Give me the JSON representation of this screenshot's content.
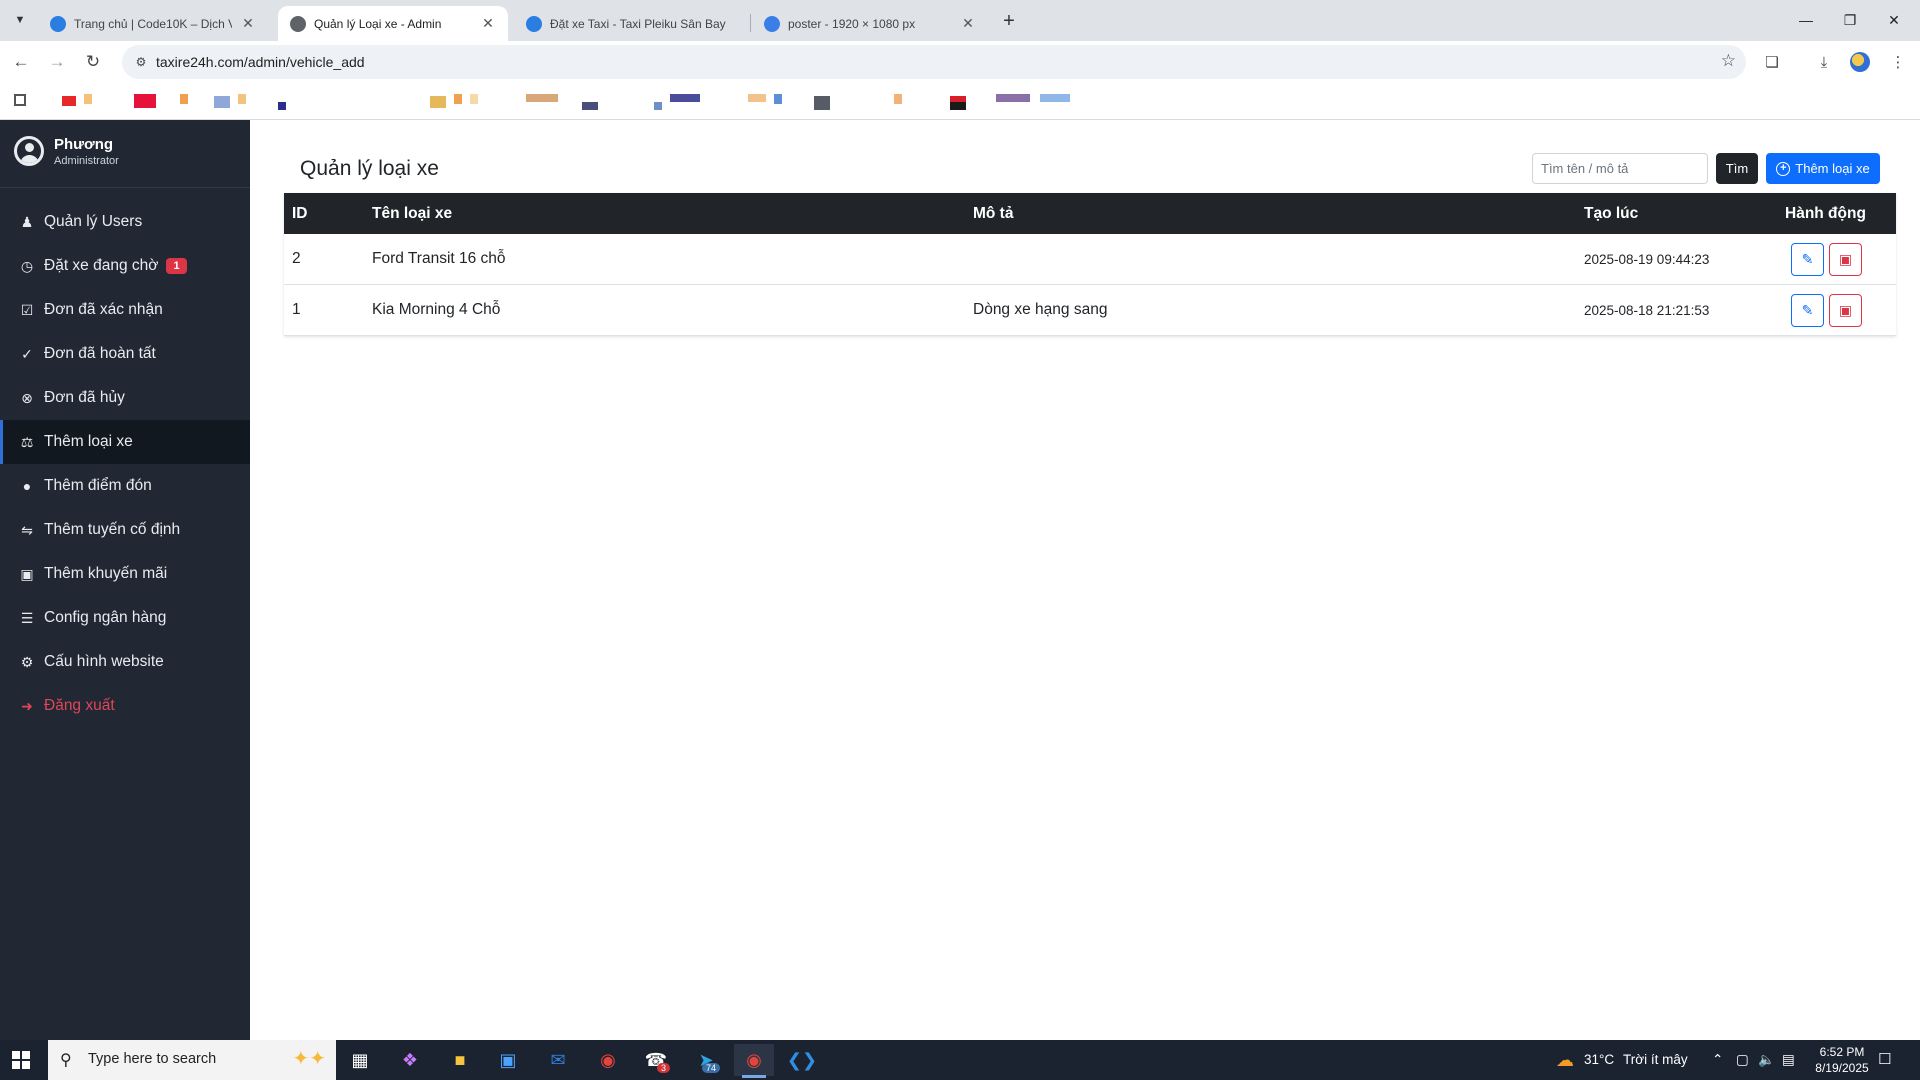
{
  "browser": {
    "tabs": [
      {
        "label": "Trang chủ | Code10K – Dịch Vụ",
        "active": false
      },
      {
        "label": "Quản lý Loại xe - Admin",
        "active": true
      },
      {
        "label": "Đặt xe Taxi - Taxi Pleiku Sân Bay",
        "active": false
      },
      {
        "label": "poster - 1920 × 1080 px",
        "active": false
      }
    ],
    "url": "taxire24h.com/admin/vehicle_add"
  },
  "sidebar": {
    "user_name": "Phương",
    "user_role": "Administrator",
    "items": [
      {
        "label": "Quản lý Users",
        "icon": "users-icon"
      },
      {
        "label": "Đặt xe đang chờ",
        "icon": "clock-icon",
        "badge": "1"
      },
      {
        "label": "Đơn đã xác nhận",
        "icon": "clipboard-check-icon"
      },
      {
        "label": "Đơn đã hoàn tất",
        "icon": "check-circle-icon"
      },
      {
        "label": "Đơn đã hủy",
        "icon": "x-circle-icon"
      },
      {
        "label": "Thêm loại xe",
        "icon": "car-icon",
        "active": true
      },
      {
        "label": "Thêm điểm đón",
        "icon": "map-pin-icon"
      },
      {
        "label": "Thêm tuyến cố định",
        "icon": "route-icon"
      },
      {
        "label": "Thêm khuyến mãi",
        "icon": "gift-icon"
      },
      {
        "label": "Config ngân hàng",
        "icon": "bank-icon"
      },
      {
        "label": "Cấu hình website",
        "icon": "gear-icon"
      },
      {
        "label": "Đăng xuất",
        "icon": "logout-icon"
      }
    ]
  },
  "main": {
    "title": "Quản lý loại xe",
    "search_placeholder": "Tìm tên / mô tả",
    "search_button": "Tìm",
    "add_button": "Thêm loại xe",
    "table": {
      "headers": [
        "ID",
        "Tên loại xe",
        "Mô tả",
        "Tạo lúc",
        "Hành động"
      ],
      "rows": [
        {
          "id": "2",
          "name": "Ford Transit 16 chỗ",
          "desc": "",
          "created": "2025-08-19 09:44:23"
        },
        {
          "id": "1",
          "name": "Kia Morning 4 Chỗ",
          "desc": "Dòng xe hạng sang",
          "created": "2025-08-18 21:21:53"
        }
      ]
    }
  },
  "taskbar": {
    "search_text": "Type here to search",
    "weather_temp": "31°C",
    "weather_text": "Trời ít mây",
    "time": "6:52 PM",
    "date": "8/19/2025",
    "telegram_badge": "3",
    "telegram2_badge": "74"
  },
  "colors": {
    "sidebar_bg": "#212833",
    "primary": "#0d6efd",
    "danger": "#dc3545",
    "table_header": "#212529"
  }
}
